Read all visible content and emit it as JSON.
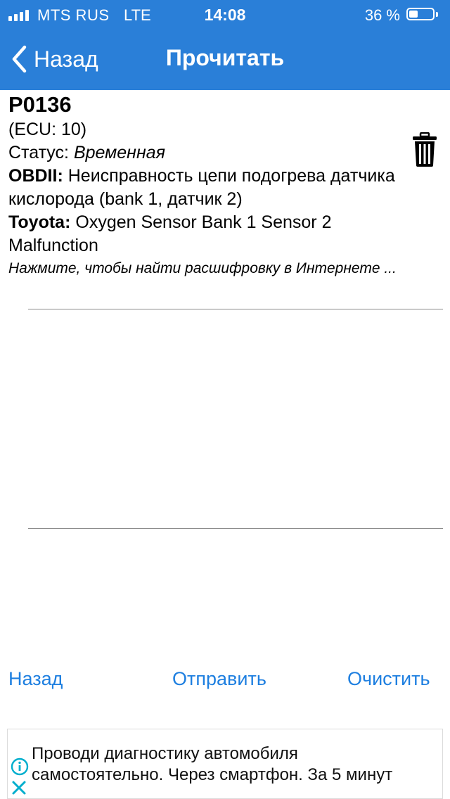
{
  "status_bar": {
    "carrier": "MTS RUS",
    "network": "LTE",
    "time": "14:08",
    "battery_percent": "36 %",
    "battery_level": 0.36
  },
  "nav": {
    "back_label": "Назад",
    "title": "Прочитать"
  },
  "code": {
    "code": "P0136",
    "ecu": "(ECU: 10)",
    "status_label": "Статус:",
    "status_value": "Временная",
    "obd_label": "OBDII:",
    "obd_description": "Неисправность цепи подогрева датчика кислорода (bank 1, датчик 2)",
    "maker_label": "Toyota:",
    "maker_description": "Oxygen Sensor Bank 1 Sensor 2 Malfunction",
    "lookup_hint": "Нажмите, чтобы найти расшифровку в Интернете ..."
  },
  "actions": {
    "back": "Назад",
    "send": "Отправить",
    "clear": "Очистить"
  },
  "ad": {
    "text": "Проводи диагностику автомобиля самостоятельно. Через смартфон. За 5 минут",
    "line1": "Проводи диагностику автомобиля",
    "line2": "самостоятельно. Через смартфон. За 5 минут"
  },
  "colors": {
    "accent": "#2A7FD8",
    "link": "#1E7FE0",
    "divider": "#8a8a8a"
  },
  "icons": {
    "trash": "trash-icon",
    "back": "chevron-left-icon",
    "ad_info": "info-icon",
    "ad_close": "close-icon"
  }
}
